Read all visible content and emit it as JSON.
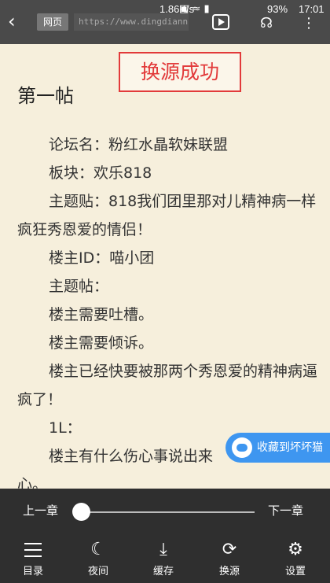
{
  "status": {
    "speed": "1.86K/s",
    "battery": "93%",
    "time": "17:01"
  },
  "browser": {
    "web_badge": "网页",
    "url": "https://www.dingdiann.coi"
  },
  "toast": "换源成功",
  "chapter": {
    "title": "第一帖",
    "paragraphs": [
      "论坛名：粉红水晶软妹联盟",
      "板块：欢乐818",
      "主题贴：818我们团里那对儿精神病一样疯狂秀恩爱的情侣！",
      "楼主ID：喵小团",
      "主题帖：",
      "楼主需要吐槽。",
      "楼主需要倾诉。",
      "楼主已经快要被那两个秀恩爱的精神病逼疯了！",
      "1L：",
      "楼主有什么伤心事说出来",
      "心。"
    ]
  },
  "favorite": {
    "label": "收藏到坏坏猫"
  },
  "controls": {
    "prev_chapter": "上一章",
    "next_chapter": "下一章",
    "progress": 0.0,
    "tools": [
      {
        "label": "目录",
        "icon": "menu-icon"
      },
      {
        "label": "夜间",
        "icon": "moon-icon"
      },
      {
        "label": "缓存",
        "icon": "download-icon"
      },
      {
        "label": "换源",
        "icon": "refresh-icon"
      },
      {
        "label": "设置",
        "icon": "gear-icon"
      }
    ]
  }
}
